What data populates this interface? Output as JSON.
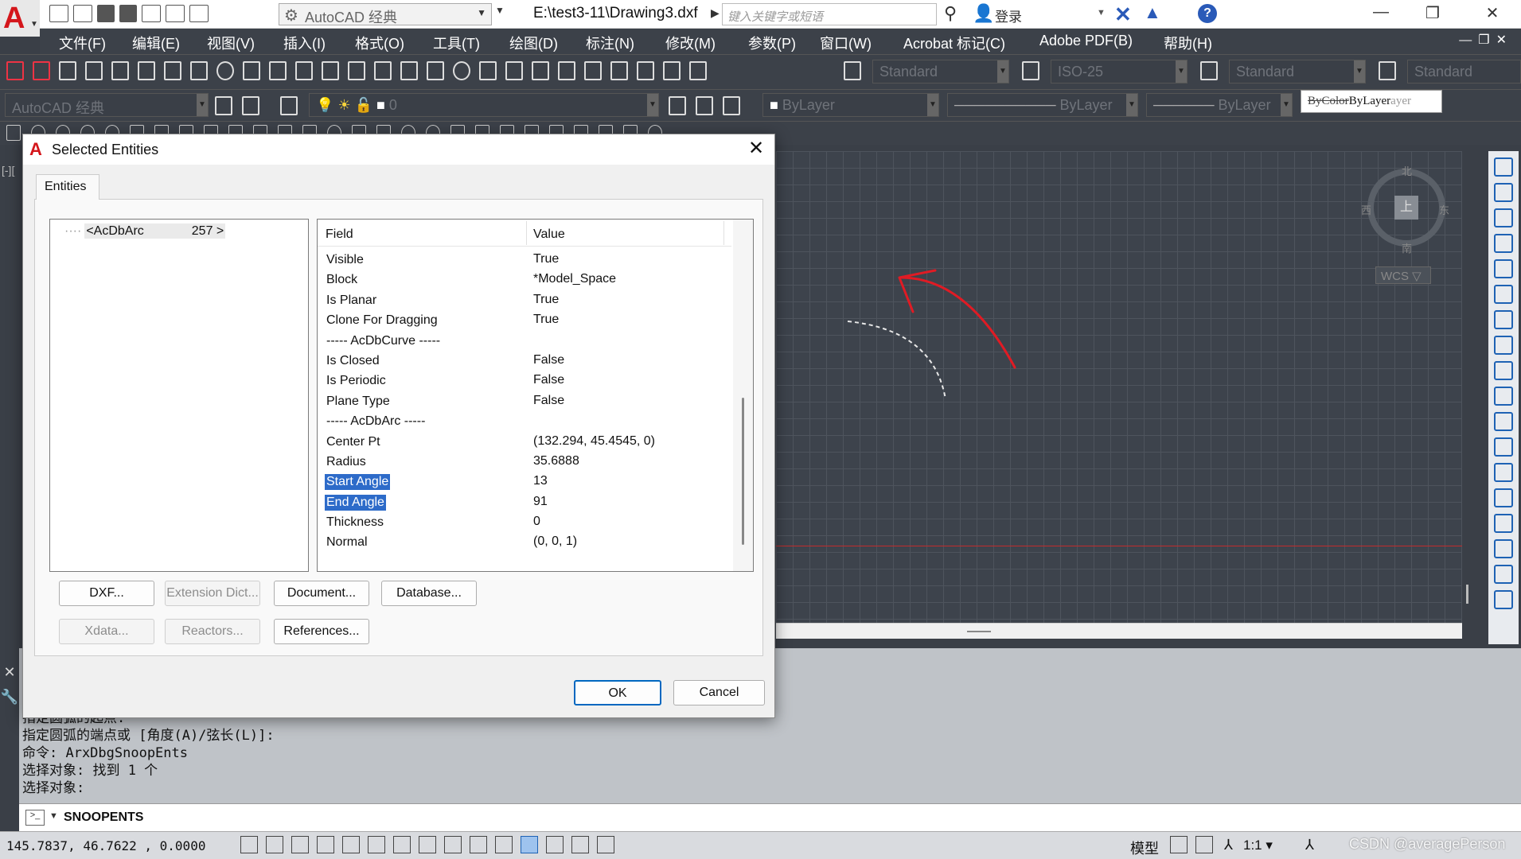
{
  "titlebar": {
    "workspace": "AutoCAD 经典",
    "file_title": "E:\\test3-11\\Drawing3.dxf",
    "search_placeholder": "键入关键字或短语",
    "login": "登录"
  },
  "menubar": {
    "items": [
      "文件(F)",
      "编辑(E)",
      "视图(V)",
      "插入(I)",
      "格式(O)",
      "工具(T)",
      "绘图(D)",
      "标注(N)",
      "修改(M)",
      "参数(P)",
      "窗口(W)",
      "Acrobat 标记(C)",
      "Adobe PDF(B)",
      "帮助(H)"
    ]
  },
  "toolbars": {
    "text_style": "Standard",
    "dim_style": "ISO-25",
    "table_style": "Standard",
    "multileader_style": "Standard",
    "workspace2": "AutoCAD 经典",
    "layer": "0",
    "color": "ByLayer",
    "linetype": "ByLayer",
    "lineweight": "ByLayer",
    "plotstyle_strike": "ByColor",
    "plotstyle": "ByLayer",
    "plotstyle_tail": "ayer"
  },
  "drawing": {
    "viewport_label": "[-][",
    "viewcube_top": "上",
    "viewcube_n": "北",
    "viewcube_s": "南",
    "viewcube_e": "东",
    "viewcube_w": "西",
    "wcs": "WCS ▽"
  },
  "dialog": {
    "title": "Selected Entities",
    "tab": "Entities",
    "tree": {
      "dots": "····",
      "node": "<AcDbArc",
      "id": "257 >"
    },
    "headers": {
      "field": "Field",
      "value": "Value"
    },
    "rows": [
      {
        "field": "Visible",
        "value": "True"
      },
      {
        "field": "Block",
        "value": "*Model_Space"
      },
      {
        "field": "Is Planar",
        "value": "True"
      },
      {
        "field": "Clone For Dragging",
        "value": "True"
      },
      {
        "field": "----- AcDbCurve -----",
        "value": ""
      },
      {
        "field": "Is Closed",
        "value": "False"
      },
      {
        "field": "Is Periodic",
        "value": "False"
      },
      {
        "field": "Plane Type",
        "value": "False"
      },
      {
        "field": "----- AcDbArc -----",
        "value": ""
      },
      {
        "field": "Center Pt",
        "value": "(132.294, 45.4545, 0)"
      },
      {
        "field": "Radius",
        "value": "35.6888"
      },
      {
        "field": "Start Angle",
        "value": "13",
        "highlight": true
      },
      {
        "field": "End Angle",
        "value": "91",
        "highlight": true
      },
      {
        "field": "Thickness",
        "value": "0"
      },
      {
        "field": "Normal",
        "value": "(0, 0, 1)"
      }
    ],
    "buttons": {
      "dxf": "DXF...",
      "extension_dict": "Extension Dict...",
      "document": "Document...",
      "database": "Database...",
      "xdata": "Xdata...",
      "reactors": "Reactors...",
      "references": "References...",
      "ok": "OK",
      "cancel": "Cancel"
    }
  },
  "command": {
    "history": [
      "指定圆弧的起点:",
      "指定圆弧的端点或 [角度(A)/弦长(L)]:",
      "命令: ArxDbgSnoopEnts",
      "选择对象: 找到 1 个",
      "选择对象:"
    ],
    "input": "SNOOPENTS"
  },
  "statusbar": {
    "coords": "145.7837,  46.7622 ,  0.0000",
    "model": "模型",
    "scale": "1:1 ▾",
    "watermark": "CSDN @averagePerson"
  },
  "colors": {
    "accent": "#2d6bc9",
    "autocad_red": "#d4161b",
    "annotation_arrow": "#e01b24"
  }
}
